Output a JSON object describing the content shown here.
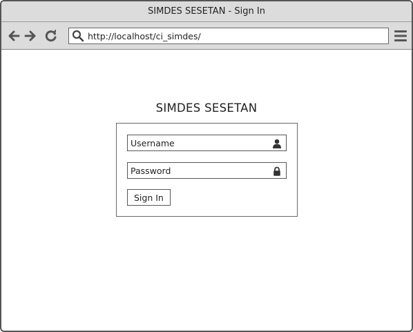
{
  "window": {
    "title": "SIMDES SESETAN - Sign In"
  },
  "browser": {
    "address_url": "http://localhost/ci_simdes/",
    "icons": {
      "back": "back-arrow-icon",
      "forward": "forward-arrow-icon",
      "reload": "reload-icon",
      "search": "search-icon",
      "menu": "hamburger-menu-icon"
    }
  },
  "page": {
    "heading": "SIMDES SESETAN",
    "login": {
      "username_placeholder": "Username",
      "password_placeholder": "Password",
      "signin_label": "Sign In"
    }
  }
}
